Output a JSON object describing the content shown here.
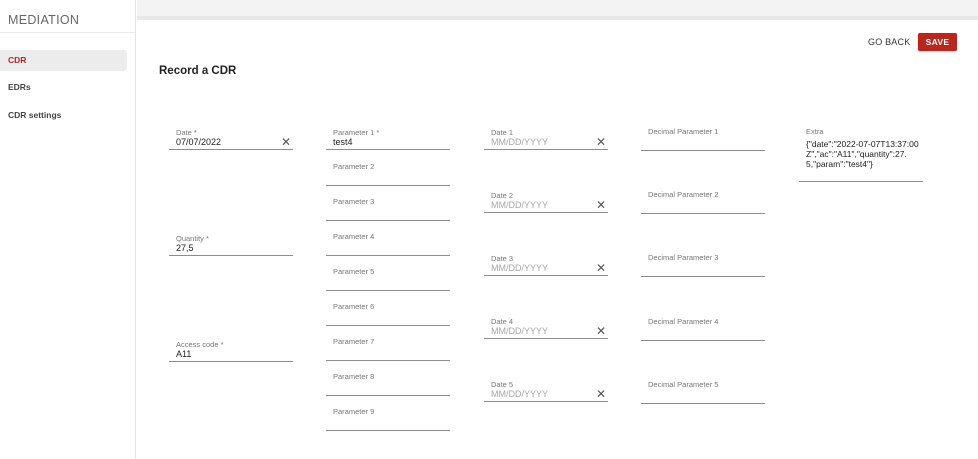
{
  "sidebar": {
    "brand": "MEDIATION",
    "items": [
      {
        "label": "CDR",
        "active": true
      },
      {
        "label": "EDRs",
        "active": false
      },
      {
        "label": "CDR settings",
        "active": false
      }
    ]
  },
  "header": {
    "title": "Record a CDR",
    "go_back_label": "GO BACK",
    "save_label": "SAVE"
  },
  "form": {
    "date": {
      "label": "Date *",
      "value": "07/07/2022"
    },
    "quantity": {
      "label": "Quantity *",
      "value": "27,5"
    },
    "access_code": {
      "label": "Access code *",
      "value": "A11"
    },
    "parameters": [
      {
        "label": "Parameter 1 *",
        "value": "test4"
      },
      {
        "label": "Parameter 2",
        "value": ""
      },
      {
        "label": "Parameter 3",
        "value": ""
      },
      {
        "label": "Parameter 4",
        "value": ""
      },
      {
        "label": "Parameter 5",
        "value": ""
      },
      {
        "label": "Parameter 6",
        "value": ""
      },
      {
        "label": "Parameter 7",
        "value": ""
      },
      {
        "label": "Parameter 8",
        "value": ""
      },
      {
        "label": "Parameter 9",
        "value": ""
      }
    ],
    "dates": [
      {
        "label": "Date 1",
        "placeholder": "MM/DD/YYYY"
      },
      {
        "label": "Date 2",
        "placeholder": "MM/DD/YYYY"
      },
      {
        "label": "Date 3",
        "placeholder": "MM/DD/YYYY"
      },
      {
        "label": "Date 4",
        "placeholder": "MM/DD/YYYY"
      },
      {
        "label": "Date 5",
        "placeholder": "MM/DD/YYYY"
      }
    ],
    "decimals": [
      {
        "label": "Decimal Parameter 1"
      },
      {
        "label": "Decimal Parameter 2"
      },
      {
        "label": "Decimal Parameter 3"
      },
      {
        "label": "Decimal Parameter 4"
      },
      {
        "label": "Decimal Parameter 5"
      }
    ],
    "extra": {
      "label": "Extra",
      "value": "{\"date\":\"2022-07-07T13:37:00Z\",\"ac\":\"A11\",\"quantity\":27.5,\"param\":\"test4\"}"
    }
  },
  "icons": {
    "clear": "close-icon"
  },
  "colors": {
    "accent": "#b5271f",
    "active_bg": "#ececec"
  }
}
